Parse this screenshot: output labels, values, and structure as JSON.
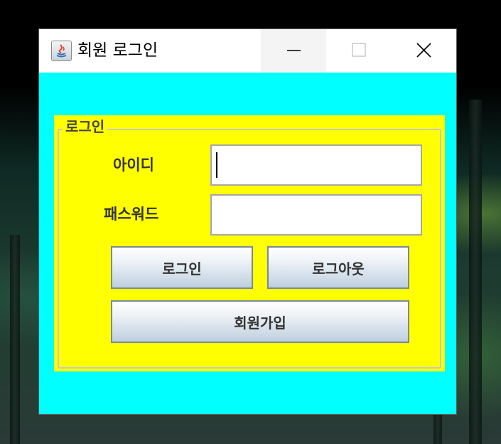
{
  "window": {
    "title": "회원 로그인"
  },
  "login_panel": {
    "legend": "로그인",
    "id_label": "아이디",
    "id_value": "",
    "password_label": "패스워드",
    "password_value": "",
    "login_button": "로그인",
    "logout_button": "로그아웃",
    "signup_button": "회원가입"
  },
  "colors": {
    "window_background": "#00ffff",
    "panel_background": "#ffff00"
  }
}
